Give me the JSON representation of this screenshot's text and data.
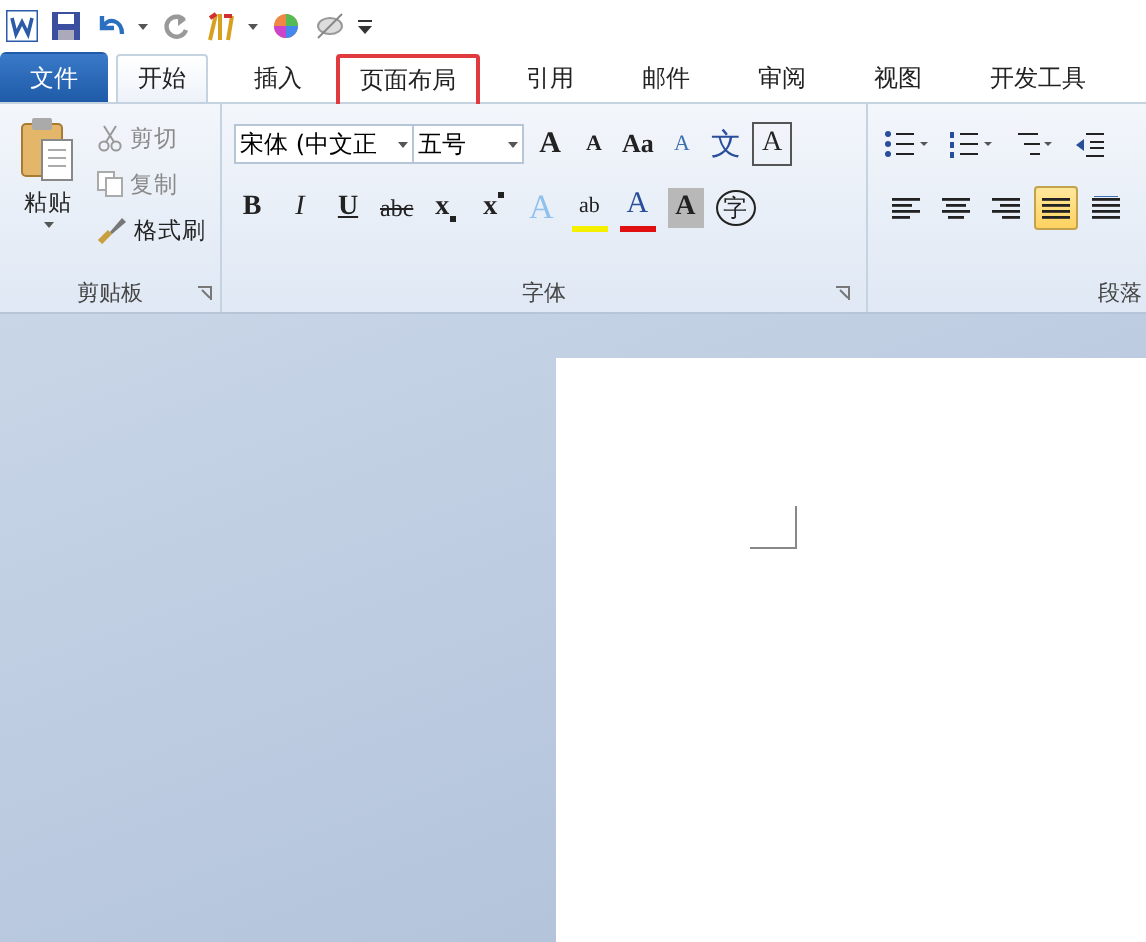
{
  "tabs": [
    {
      "label": "文件",
      "kind": "file",
      "selected": false,
      "marked": false
    },
    {
      "label": "开始",
      "kind": "tab",
      "selected": true,
      "marked": false
    },
    {
      "label": "插入",
      "kind": "tab",
      "selected": false,
      "marked": false
    },
    {
      "label": "页面布局",
      "kind": "tab",
      "selected": false,
      "marked": true
    },
    {
      "label": "引用",
      "kind": "tab",
      "selected": false,
      "marked": false
    },
    {
      "label": "邮件",
      "kind": "tab",
      "selected": false,
      "marked": false
    },
    {
      "label": "审阅",
      "kind": "tab",
      "selected": false,
      "marked": false
    },
    {
      "label": "视图",
      "kind": "tab",
      "selected": false,
      "marked": false
    },
    {
      "label": "开发工具",
      "kind": "tab",
      "selected": false,
      "marked": false
    }
  ],
  "clipboard": {
    "paste": "粘贴",
    "cut": "剪切",
    "copy": "复制",
    "format_painter": "格式刷",
    "label": "剪贴板"
  },
  "font": {
    "font_name": "宋体 (中文正",
    "font_size": "五号",
    "label": "字体",
    "row1": [
      {
        "kind": "grow",
        "text": "A"
      },
      {
        "kind": "shrink",
        "text": "A"
      },
      {
        "kind": "case",
        "text": "Aa"
      },
      {
        "kind": "clear",
        "text": "A"
      },
      {
        "kind": "phonetic",
        "text": "文"
      },
      {
        "kind": "border",
        "text": "A"
      }
    ],
    "row2": [
      {
        "kind": "bold",
        "text": "B"
      },
      {
        "kind": "italic",
        "text": "I"
      },
      {
        "kind": "underline",
        "text": "U"
      },
      {
        "kind": "strike",
        "text": "abc"
      },
      {
        "kind": "sub",
        "text": "x"
      },
      {
        "kind": "sup",
        "text": "x"
      },
      {
        "kind": "effects",
        "text": "A"
      },
      {
        "kind": "highlight",
        "text": "ab"
      },
      {
        "kind": "color",
        "text": "A"
      },
      {
        "kind": "shading",
        "text": "A"
      },
      {
        "kind": "enclose",
        "text": "字"
      }
    ]
  },
  "paragraph": {
    "label": "段落",
    "alignments": [
      {
        "kind": "left",
        "selected": false
      },
      {
        "kind": "center",
        "selected": false
      },
      {
        "kind": "right",
        "selected": false
      },
      {
        "kind": "justify",
        "selected": true
      },
      {
        "kind": "distributed",
        "selected": false
      }
    ]
  }
}
